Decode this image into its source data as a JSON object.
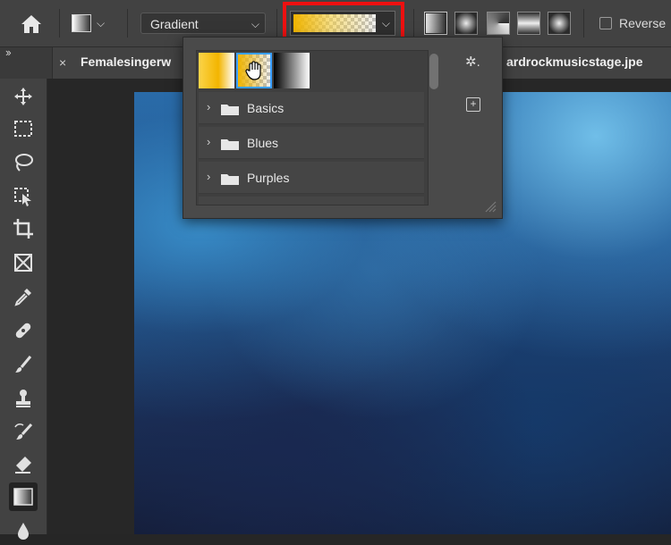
{
  "options_bar": {
    "mode_label": "Gradient",
    "reverse_label": "Reverse",
    "gradient_types": [
      "linear",
      "radial",
      "angle",
      "reflected",
      "diamond"
    ]
  },
  "document": {
    "tab_title_left": "Femalesingerw",
    "tab_title_right": "ardrockmusicstage.jpe",
    "close_glyph": "×"
  },
  "gradient_picker": {
    "folders": [
      {
        "label": "Basics"
      },
      {
        "label": "Blues"
      },
      {
        "label": "Purples"
      }
    ]
  },
  "tools": [
    "move",
    "marquee",
    "lasso",
    "object-select",
    "crop",
    "frame",
    "eyedropper",
    "healing",
    "brush",
    "stamp",
    "history-brush",
    "eraser",
    "gradient",
    "blur"
  ],
  "colors": {
    "highlight": "#ee1010",
    "selection": "#3aa0ff",
    "gradient_start": "#f3b500"
  }
}
